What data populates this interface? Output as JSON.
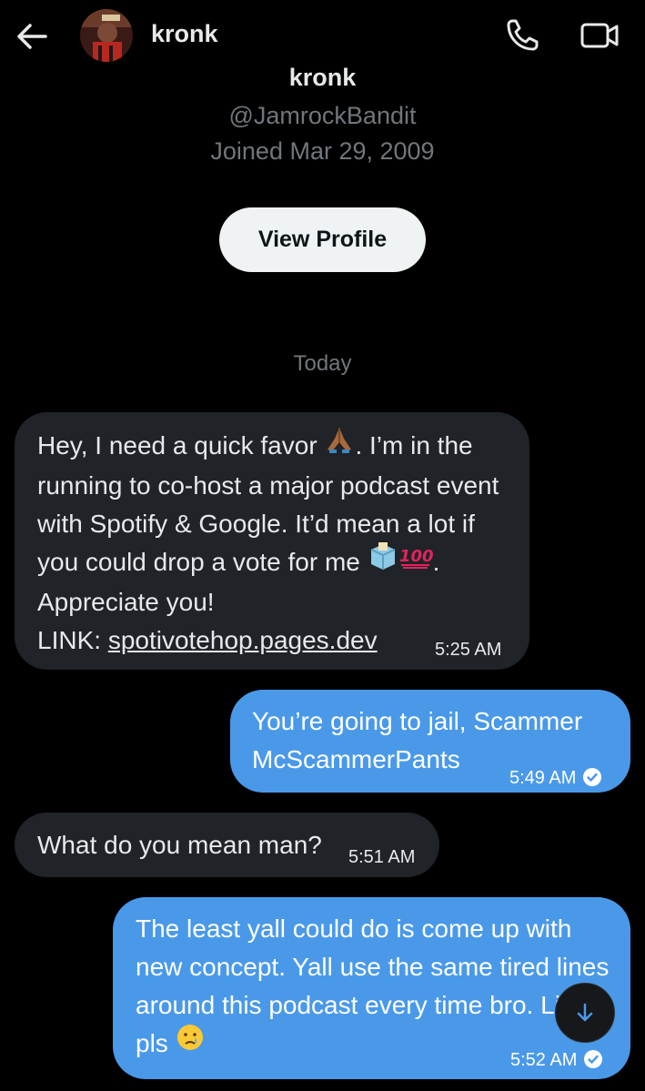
{
  "header": {
    "name": "kronk",
    "icons": {
      "back": "arrow-left-icon",
      "call": "phone-icon",
      "video": "video-camera-icon"
    }
  },
  "profile": {
    "name": "kronk",
    "handle": "@JamrockBandit",
    "joined": "Joined Mar 29, 2009",
    "view_button": "View Profile"
  },
  "date_separator": "Today",
  "messages": [
    {
      "direction": "incoming",
      "text_a": "Hey, I need a quick favor ",
      "text_b": ". I’m in the running to co-host a major podcast event with Spotify & Google. It’d mean a lot if you could drop a vote for me ",
      "text_c": ". Appreciate you!",
      "link_prefix": "LINK: ",
      "link": "spotivotehop.pages.dev",
      "time": "5:25 AM"
    },
    {
      "direction": "outgoing",
      "text": "You’re going to jail, Scammer McScammerPants",
      "time": "5:49 AM",
      "read": true
    },
    {
      "direction": "incoming",
      "text": "What do you mean man?",
      "time": "5:51 AM"
    },
    {
      "direction": "outgoing",
      "text": "The least yall could do is come up with new concept. Yall use the same tired lines around this podcast every time bro. Like pls ",
      "time": "5:52 AM",
      "read": true
    }
  ],
  "colors": {
    "background": "#000000",
    "incoming_bubble": "#202327",
    "outgoing_bubble": "#4a99e9",
    "muted_text": "#71767b"
  }
}
